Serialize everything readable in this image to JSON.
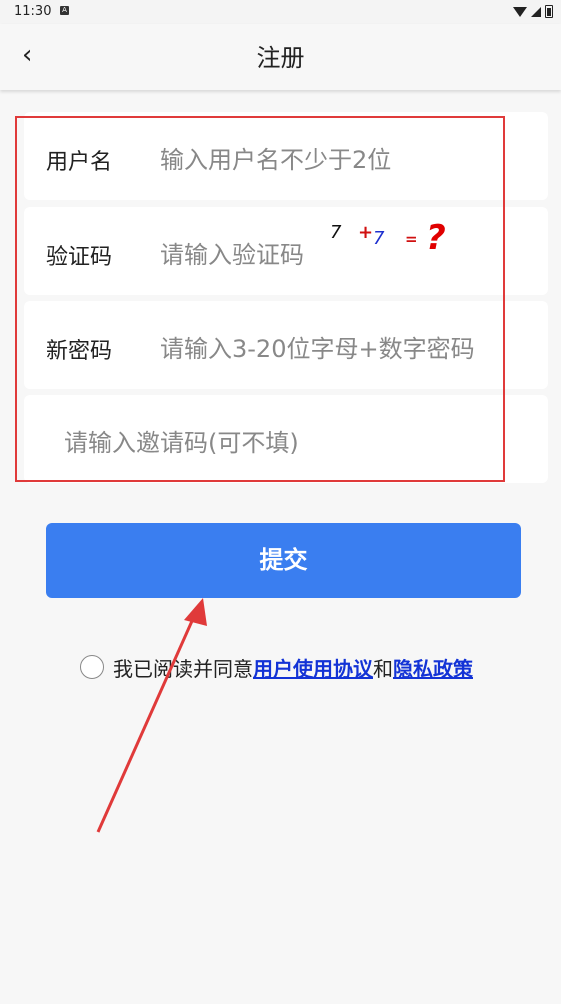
{
  "status": {
    "time": "11:30",
    "notif_icon": "A"
  },
  "appbar": {
    "back_icon": "‹",
    "title": "注册"
  },
  "form": {
    "username": {
      "label": "用户名",
      "placeholder": "输入用户名不少于2位"
    },
    "captcha": {
      "label": "验证码",
      "placeholder": "请输入验证码",
      "a": "7",
      "op": "+",
      "b": "7",
      "eq": "=",
      "q": "?"
    },
    "password": {
      "label": "新密码",
      "placeholder": "请输入3-20位字母+数字密码"
    },
    "invite": {
      "placeholder": "请输入邀请码(可不填)"
    }
  },
  "submit_label": "提交",
  "agreement": {
    "prefix": "我已阅读并同意",
    "terms": "用户使用协议",
    "and": "和",
    "privacy": "隐私政策"
  },
  "colors": {
    "accent": "#3a7ef0",
    "highlight_box": "#e03a3a",
    "link": "#1333d6"
  }
}
